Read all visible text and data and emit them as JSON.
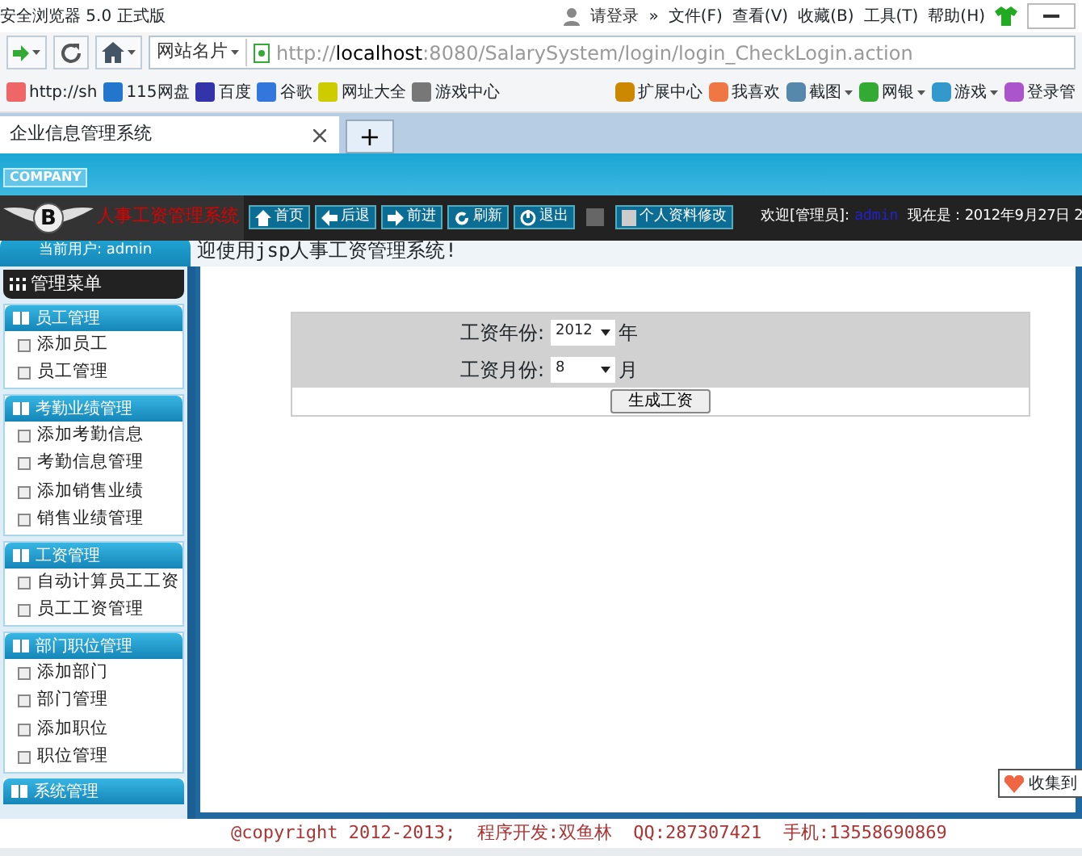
{
  "browser": {
    "title": "安全浏览器 5.0 正式版",
    "login_link": "请登录",
    "more": "»",
    "menu": [
      "文件(F)",
      "查看(V)",
      "收藏(B)",
      "工具(T)",
      "帮助(H)"
    ],
    "site_card": "网站名片",
    "url_host": "localhost",
    "url_prefix": "http://",
    "url_rest": ":8080/SalarySystem/login/login_CheckLogin.action",
    "bookmarks": [
      "http://sh",
      "115网盘",
      "百度",
      "谷歌",
      "网址大全",
      "游戏中心"
    ],
    "tools": [
      {
        "label": "扩展中心",
        "dropdown": false
      },
      {
        "label": "我喜欢",
        "dropdown": false
      },
      {
        "label": "截图",
        "dropdown": true
      },
      {
        "label": "网银",
        "dropdown": true
      },
      {
        "label": "游戏",
        "dropdown": true
      },
      {
        "label": "登录管",
        "dropdown": false
      }
    ],
    "tabs": [
      {
        "label": "企业信息管理系统",
        "selected": true
      }
    ],
    "new_tab": "+"
  },
  "header": {
    "company": "COMPANY",
    "logo_letter": "B",
    "system_title": "人事工资管理系统",
    "nav": [
      "首页",
      "后退",
      "前进",
      "刷新",
      "退出"
    ],
    "profile_button": "个人资料修改",
    "welcome": "欢迎[管理员]:",
    "user": "admin",
    "date_text": "现在是：2012年9月27日 2"
  },
  "current_user": "当前用户: admin",
  "welcome_banner": "迎使用jsp人事工资管理系统!",
  "sidebar": {
    "title": "管理菜单",
    "sections": [
      {
        "title": "员工管理",
        "items": [
          "添加员工",
          "员工管理"
        ]
      },
      {
        "title": "考勤业绩管理",
        "items": [
          "添加考勤信息",
          "考勤信息管理",
          "添加销售业绩",
          "销售业绩管理"
        ]
      },
      {
        "title": "工资管理",
        "items": [
          "自动计算员工工资",
          "员工工资管理"
        ]
      },
      {
        "title": "部门职位管理",
        "items": [
          "添加部门",
          "部门管理",
          "添加职位",
          "职位管理"
        ]
      },
      {
        "title": "系统管理"
      }
    ]
  },
  "form": {
    "rows": [
      {
        "label": "工资年份:",
        "value": "2012",
        "unit": "年"
      },
      {
        "label": "工资月份:",
        "value": "8",
        "unit": "月"
      }
    ],
    "submit": "生成工资"
  },
  "collect_button": "收集到",
  "footer": "@copyright 2012-2013;  程序开发:双鱼林  QQ:287307421  手机:13558690869"
}
